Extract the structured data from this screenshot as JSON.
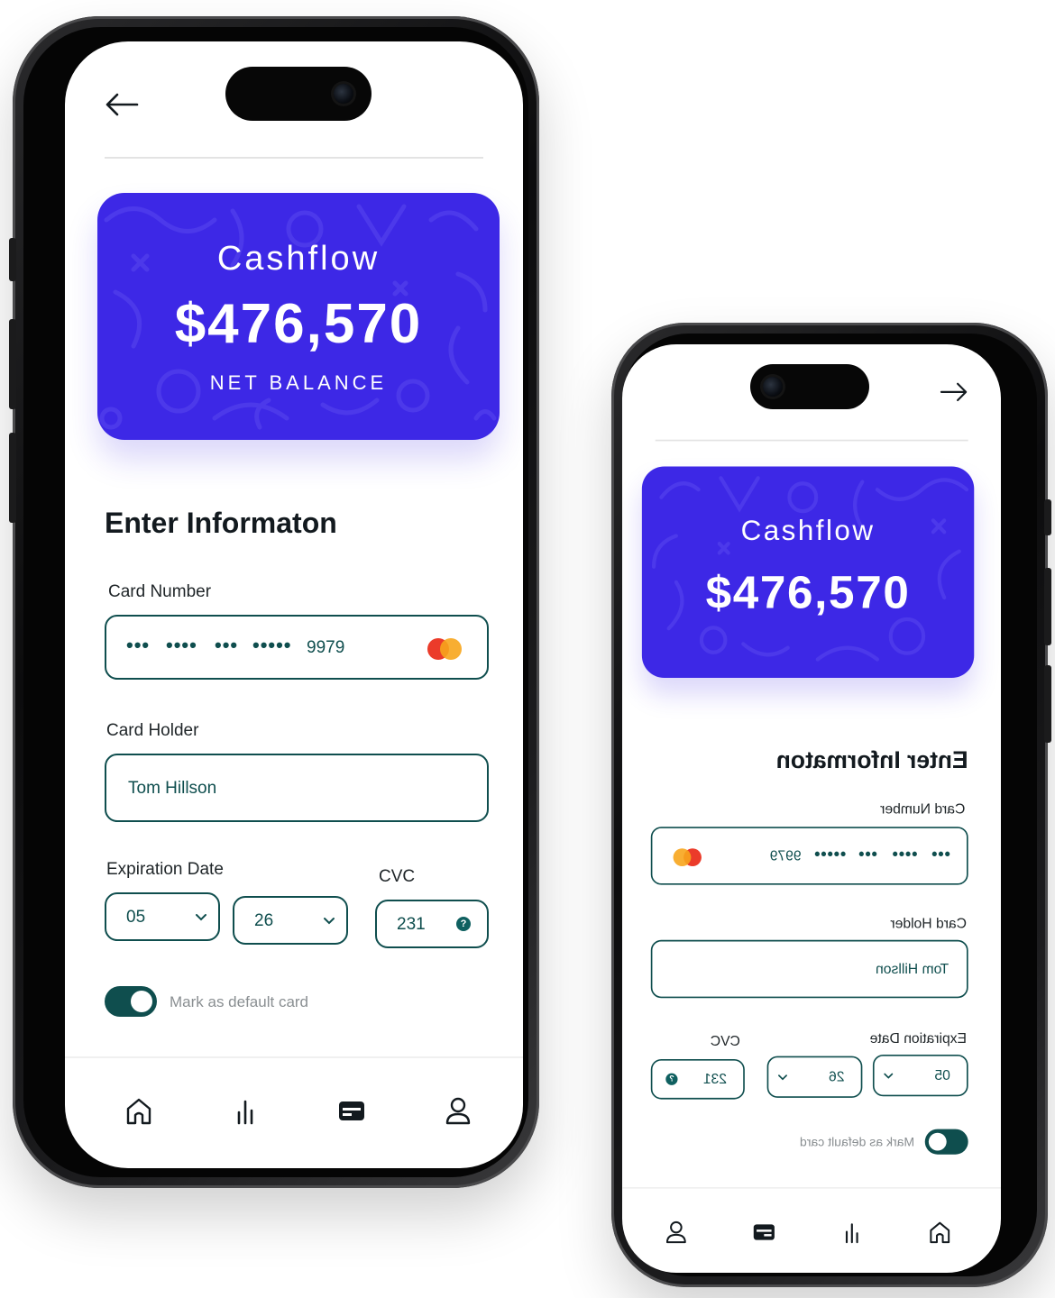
{
  "card": {
    "title": "Cashflow",
    "amount": "$476,570",
    "subtitle": "NET BALANCE",
    "color": "#3d28e6"
  },
  "form": {
    "title": "Enter Informaton",
    "card_number": {
      "label": "Card Number",
      "masked_groups": [
        "•••",
        "••••",
        "•••",
        "•••••"
      ],
      "last_digits": "9979",
      "brand_icon": "mastercard-icon"
    },
    "card_holder": {
      "label": "Card Holder",
      "value": "Tom Hillson"
    },
    "expiration": {
      "label": "Expiration Date",
      "month": "05",
      "year": "26"
    },
    "cvc": {
      "label": "CVC",
      "value": "231",
      "help_icon": "help-icon"
    },
    "default_toggle": {
      "label": "Mark as default card",
      "on": true
    }
  },
  "nav": {
    "back_icon": "arrow-left-icon",
    "tabs": [
      {
        "icon": "home-icon",
        "active": false
      },
      {
        "icon": "stats-icon",
        "active": false
      },
      {
        "icon": "card-icon",
        "active": true
      },
      {
        "icon": "profile-icon",
        "active": false
      }
    ]
  },
  "colors": {
    "accent": "#0f4e4e",
    "card": "#3d28e6",
    "text": "#131a1f"
  }
}
